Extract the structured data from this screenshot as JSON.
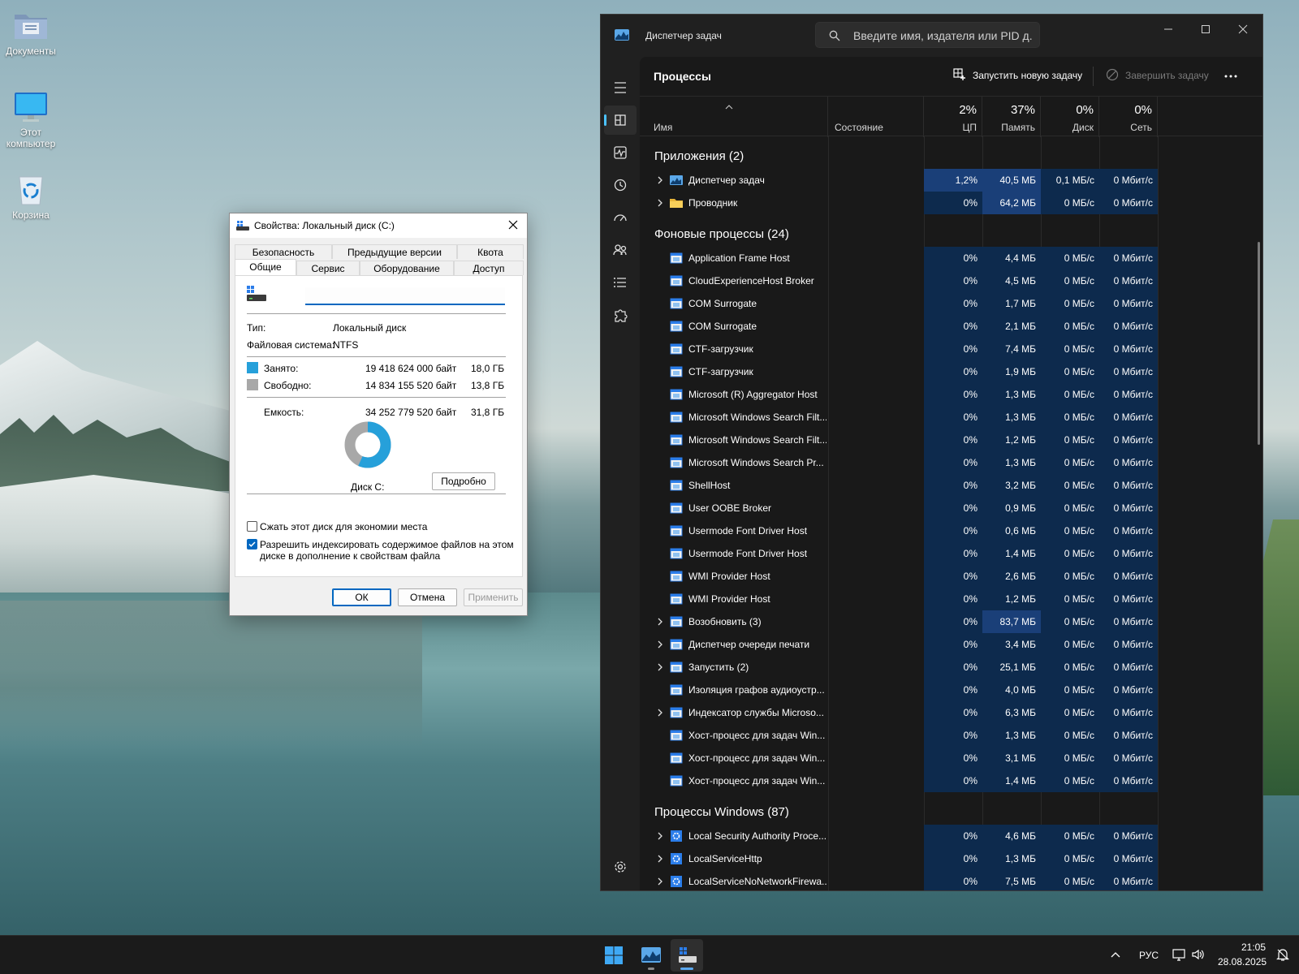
{
  "desktop": {
    "icons": [
      {
        "label": "Документы"
      },
      {
        "label": "Этот компьютер"
      },
      {
        "label": "Корзина"
      }
    ]
  },
  "task_manager": {
    "app_title": "Диспетчер задач",
    "search_placeholder": "Введите имя, издателя или PID д...",
    "page_title": "Процессы",
    "run_new_task": "Запустить новую задачу",
    "end_task": "Завершить задачу",
    "columns": {
      "name": "Имя",
      "status": "Состояние",
      "cpu_pct": "2%",
      "cpu": "ЦП",
      "mem_pct": "37%",
      "mem": "Память",
      "disk_pct": "0%",
      "disk": "Диск",
      "net_pct": "0%",
      "net": "Сеть"
    },
    "groups": {
      "apps": "Приложения (2)",
      "background": "Фоновые процессы (24)",
      "windows": "Процессы Windows (87)"
    },
    "apps": [
      {
        "name": "Диспетчер задач",
        "cpu": "1,2%",
        "mem": "40,5 МБ",
        "disk": "0,1 МБ/с",
        "net": "0 Мбит/с",
        "icon": "taskmgr"
      },
      {
        "name": "Проводник",
        "cpu": "0%",
        "mem": "64,2 МБ",
        "disk": "0 МБ/с",
        "net": "0 Мбит/с",
        "icon": "folder"
      }
    ],
    "background": [
      {
        "name": "Application Frame Host",
        "cpu": "0%",
        "mem": "4,4 МБ",
        "disk": "0 МБ/с",
        "net": "0 Мбит/с"
      },
      {
        "name": "CloudExperienceHost Broker",
        "cpu": "0%",
        "mem": "4,5 МБ",
        "disk": "0 МБ/с",
        "net": "0 Мбит/с"
      },
      {
        "name": "COM Surrogate",
        "cpu": "0%",
        "mem": "1,7 МБ",
        "disk": "0 МБ/с",
        "net": "0 Мбит/с"
      },
      {
        "name": "COM Surrogate",
        "cpu": "0%",
        "mem": "2,1 МБ",
        "disk": "0 МБ/с",
        "net": "0 Мбит/с"
      },
      {
        "name": "CTF-загрузчик",
        "cpu": "0%",
        "mem": "7,4 МБ",
        "disk": "0 МБ/с",
        "net": "0 Мбит/с"
      },
      {
        "name": "CTF-загрузчик",
        "cpu": "0%",
        "mem": "1,9 МБ",
        "disk": "0 МБ/с",
        "net": "0 Мбит/с"
      },
      {
        "name": "Microsoft (R) Aggregator Host",
        "cpu": "0%",
        "mem": "1,3 МБ",
        "disk": "0 МБ/с",
        "net": "0 Мбит/с"
      },
      {
        "name": "Microsoft Windows Search Filt...",
        "cpu": "0%",
        "mem": "1,3 МБ",
        "disk": "0 МБ/с",
        "net": "0 Мбит/с"
      },
      {
        "name": "Microsoft Windows Search Filt...",
        "cpu": "0%",
        "mem": "1,2 МБ",
        "disk": "0 МБ/с",
        "net": "0 Мбит/с"
      },
      {
        "name": "Microsoft Windows Search Pr...",
        "cpu": "0%",
        "mem": "1,3 МБ",
        "disk": "0 МБ/с",
        "net": "0 Мбит/с"
      },
      {
        "name": "ShellHost",
        "cpu": "0%",
        "mem": "3,2 МБ",
        "disk": "0 МБ/с",
        "net": "0 Мбит/с"
      },
      {
        "name": "User OOBE Broker",
        "cpu": "0%",
        "mem": "0,9 МБ",
        "disk": "0 МБ/с",
        "net": "0 Мбит/с"
      },
      {
        "name": "Usermode Font Driver Host",
        "cpu": "0%",
        "mem": "0,6 МБ",
        "disk": "0 МБ/с",
        "net": "0 Мбит/с"
      },
      {
        "name": "Usermode Font Driver Host",
        "cpu": "0%",
        "mem": "1,4 МБ",
        "disk": "0 МБ/с",
        "net": "0 Мбит/с"
      },
      {
        "name": "WMI Provider Host",
        "cpu": "0%",
        "mem": "2,6 МБ",
        "disk": "0 МБ/с",
        "net": "0 Мбит/с"
      },
      {
        "name": "WMI Provider Host",
        "cpu": "0%",
        "mem": "1,2 МБ",
        "disk": "0 МБ/с",
        "net": "0 Мбит/с"
      },
      {
        "name": "Возобновить (3)",
        "cpu": "0%",
        "mem": "83,7 МБ",
        "disk": "0 МБ/с",
        "net": "0 Мбит/с"
      },
      {
        "name": "Диспетчер очереди печати",
        "cpu": "0%",
        "mem": "3,4 МБ",
        "disk": "0 МБ/с",
        "net": "0 Мбит/с"
      },
      {
        "name": "Запустить (2)",
        "cpu": "0%",
        "mem": "25,1 МБ",
        "disk": "0 МБ/с",
        "net": "0 Мбит/с"
      },
      {
        "name": "Изоляция графов аудиоустр...",
        "cpu": "0%",
        "mem": "4,0 МБ",
        "disk": "0 МБ/с",
        "net": "0 Мбит/с"
      },
      {
        "name": "Индексатор службы Microso...",
        "cpu": "0%",
        "mem": "6,3 МБ",
        "disk": "0 МБ/с",
        "net": "0 Мбит/с"
      },
      {
        "name": "Хост-процесс для задач Win...",
        "cpu": "0%",
        "mem": "1,3 МБ",
        "disk": "0 МБ/с",
        "net": "0 Мбит/с"
      },
      {
        "name": "Хост-процесс для задач Win...",
        "cpu": "0%",
        "mem": "3,1 МБ",
        "disk": "0 МБ/с",
        "net": "0 Мбит/с"
      },
      {
        "name": "Хост-процесс для задач Win...",
        "cpu": "0%",
        "mem": "1,4 МБ",
        "disk": "0 МБ/с",
        "net": "0 Мбит/с"
      }
    ],
    "windows": [
      {
        "name": "Local Security Authority Proce...",
        "cpu": "0%",
        "mem": "4,6 МБ",
        "disk": "0 МБ/с",
        "net": "0 Мбит/с"
      },
      {
        "name": "LocalServiceHttp",
        "cpu": "0%",
        "mem": "1,3 МБ",
        "disk": "0 МБ/с",
        "net": "0 Мбит/с"
      },
      {
        "name": "LocalServiceNoNetworkFirewa...",
        "cpu": "0%",
        "mem": "7,5 МБ",
        "disk": "0 МБ/с",
        "net": "0 Мбит/с"
      }
    ]
  },
  "properties": {
    "title": "Свойства: Локальный диск (C:)",
    "tabs_back": [
      "Безопасность",
      "Предыдущие версии",
      "Квота"
    ],
    "tabs_front": [
      "Общие",
      "Сервис",
      "Оборудование",
      "Доступ"
    ],
    "type_label": "Тип:",
    "type_value": "Локальный диск",
    "fs_label": "Файловая система:",
    "fs_value": "NTFS",
    "used_label": "Занято:",
    "used_bytes": "19 418 624 000 байт",
    "used_gb": "18,0 ГБ",
    "free_label": "Свободно:",
    "free_bytes": "14 834 155 520 байт",
    "free_gb": "13,8 ГБ",
    "cap_label": "Емкость:",
    "cap_bytes": "34 252 779 520 байт",
    "cap_gb": "31,8 ГБ",
    "used_fraction": 0.567,
    "disk_label": "Диск C:",
    "details_btn": "Подробно",
    "compress_label": "Сжать этот диск для экономии места",
    "index_label_1": "Разрешить индексировать содержимое файлов на этом",
    "index_label_2": "диске в дополнение к свойствам файла",
    "ok": "ОК",
    "cancel": "Отмена",
    "apply": "Применить",
    "used_color": "#26a0da",
    "free_color": "#a8a8a8"
  },
  "taskbar": {
    "lang": "РУС",
    "time": "21:05",
    "date": "28.08.2025"
  }
}
